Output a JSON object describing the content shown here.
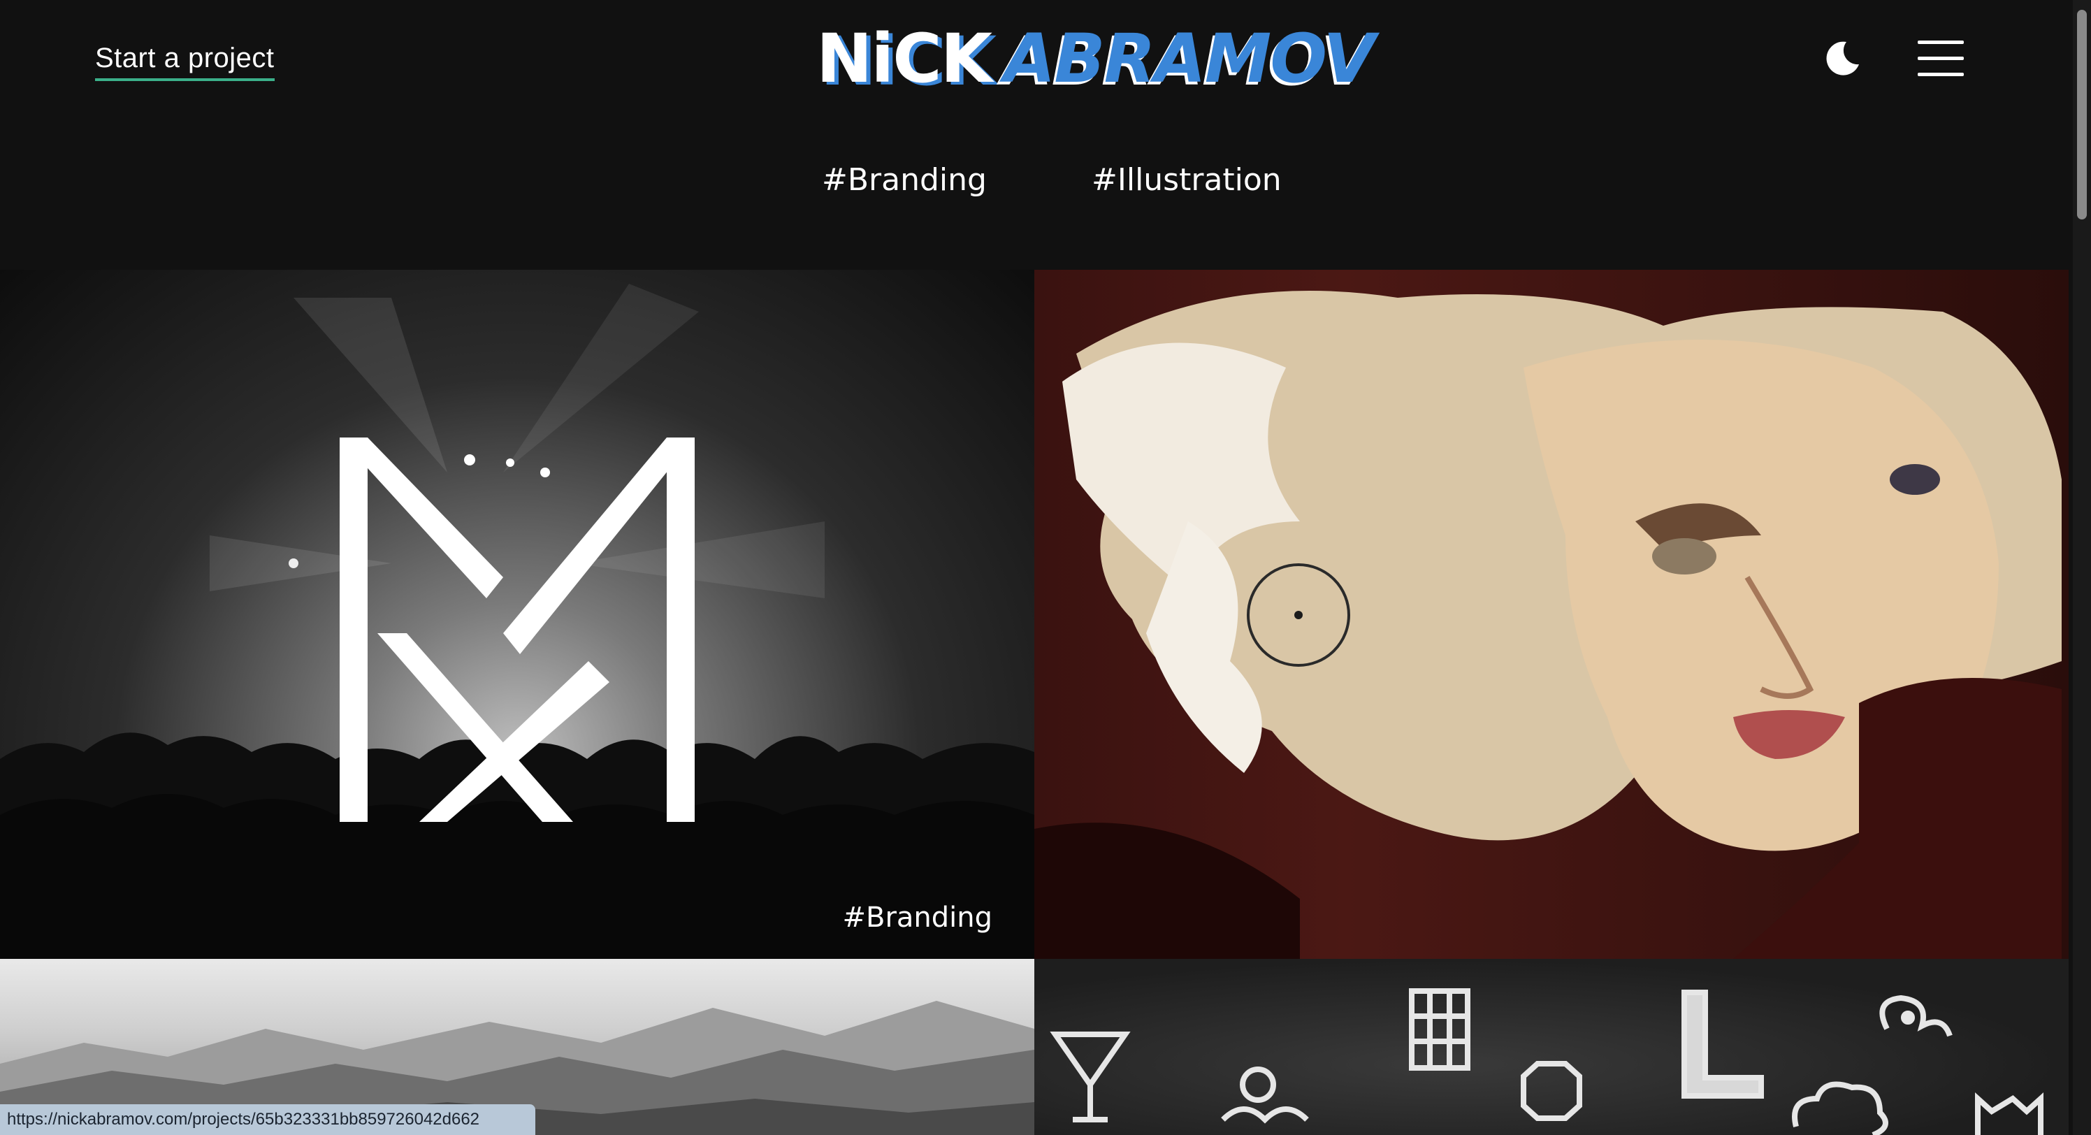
{
  "header": {
    "cta_label": "Start a project",
    "logo_first": "NiCK",
    "logo_last": "ABRAMOV",
    "filters": [
      "#Branding",
      "#Illustration"
    ]
  },
  "tiles": [
    {
      "tag": "#Branding"
    }
  ],
  "status": {
    "url": "https://nickabramov.com/projects/65b323331bb859726042d662"
  },
  "colors": {
    "background": "#111111",
    "accent_underline": "#3bb08a",
    "logo_blue": "#3a86d8"
  },
  "icons": {
    "theme_toggle": "moon-icon",
    "menu": "hamburger-icon"
  }
}
